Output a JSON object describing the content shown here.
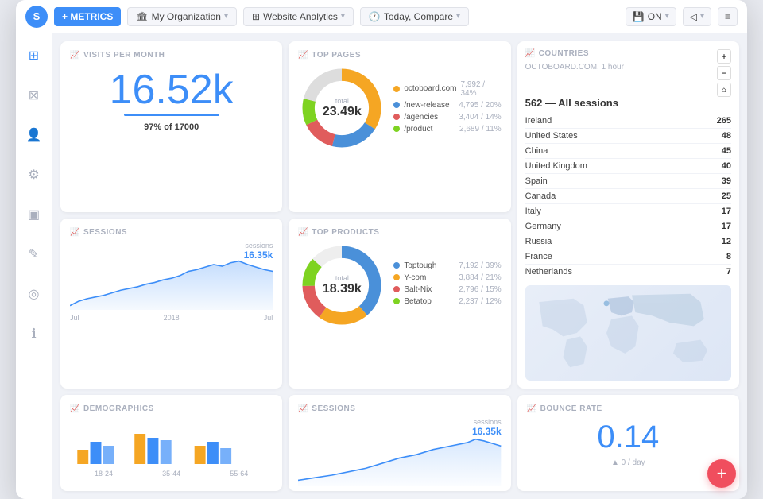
{
  "topbar": {
    "logo": "S",
    "add_metrics_label": "+ METRICS",
    "org_label": "My Organization",
    "analytics_label": "Website Analytics",
    "date_label": "Today, Compare",
    "save_label": "ON",
    "share_label": "◁",
    "menu_label": "≡"
  },
  "sidebar": {
    "items": [
      {
        "icon": "⊞",
        "name": "grid-icon"
      },
      {
        "icon": "⊠",
        "name": "modules-icon"
      },
      {
        "icon": "👤",
        "name": "user-icon"
      },
      {
        "icon": "⊞",
        "name": "settings-icon"
      },
      {
        "icon": "□",
        "name": "box-icon"
      },
      {
        "icon": "✎",
        "name": "edit-icon"
      },
      {
        "icon": "◎",
        "name": "person-icon"
      },
      {
        "icon": "ℹ",
        "name": "info-icon"
      }
    ]
  },
  "visits": {
    "title": "VISITS PER MONTH",
    "value": "16.52k",
    "percent": "97%",
    "of": "of 17000"
  },
  "toppages": {
    "title": "TOP PAGES",
    "total_label": "total",
    "total_value": "23.49k",
    "items": [
      {
        "label": "octoboard.com",
        "value": "7,992",
        "pct": "34%",
        "color": "#f5a623"
      },
      {
        "label": "/new-release",
        "value": "4,795",
        "pct": "20%",
        "color": "#4a90d9"
      },
      {
        "label": "/agencies",
        "value": "3,404",
        "pct": "14%",
        "color": "#e05c5c"
      },
      {
        "label": "/product",
        "value": "2,689",
        "pct": "11%",
        "color": "#7ed321"
      }
    ],
    "donut_colors": [
      "#f5a623",
      "#4a90d9",
      "#e05c5c",
      "#7ed321",
      "#9b59b6"
    ]
  },
  "countries": {
    "title": "COUNTRIES",
    "subtitle": "OCTOBOARD.COM, 1 hour",
    "sessions_label": "562 — All sessions",
    "items": [
      {
        "name": "Ireland",
        "value": "265"
      },
      {
        "name": "United States",
        "value": "48"
      },
      {
        "name": "China",
        "value": "45"
      },
      {
        "name": "United Kingdom",
        "value": "40"
      },
      {
        "name": "Spain",
        "value": "39"
      },
      {
        "name": "Canada",
        "value": "25"
      },
      {
        "name": "Italy",
        "value": "17"
      },
      {
        "name": "Germany",
        "value": "17"
      },
      {
        "name": "Russia",
        "value": "12"
      },
      {
        "name": "France",
        "value": "8"
      },
      {
        "name": "Netherlands",
        "value": "7"
      }
    ]
  },
  "sessions": {
    "title": "SESSIONS",
    "peak_label": "sessions",
    "peak_value": "16.35k",
    "x_labels": [
      "Jul",
      "2018",
      "Jul"
    ]
  },
  "topproducts": {
    "title": "TOP PRODUCTS",
    "total_label": "total",
    "total_value": "18.39k",
    "items": [
      {
        "label": "Toptough",
        "value": "7,192",
        "pct": "39%",
        "color": "#4a90d9"
      },
      {
        "label": "Y-com",
        "value": "3,884",
        "pct": "21%",
        "color": "#f5a623"
      },
      {
        "label": "Salt-Nix",
        "value": "2,796",
        "pct": "15%",
        "color": "#e05c5c"
      },
      {
        "label": "Betatop",
        "value": "2,237",
        "pct": "12%",
        "color": "#7ed321"
      }
    ],
    "donut_colors": [
      "#4a90d9",
      "#f5a623",
      "#e05c5c",
      "#7ed321",
      "#9b59b6"
    ]
  },
  "demographics": {
    "title": "DEMOGRAPHICS",
    "x_labels": [
      "18-24",
      "35-44",
      "55-64"
    ]
  },
  "sessions_small": {
    "title": "SESSIONS",
    "peak_label": "sessions",
    "peak_value": "16.35k"
  },
  "bounce": {
    "title": "BOUNCE RATE",
    "value": "0.14",
    "sub_label": "▲ 0 / day"
  },
  "fab": {
    "icon": "+"
  }
}
